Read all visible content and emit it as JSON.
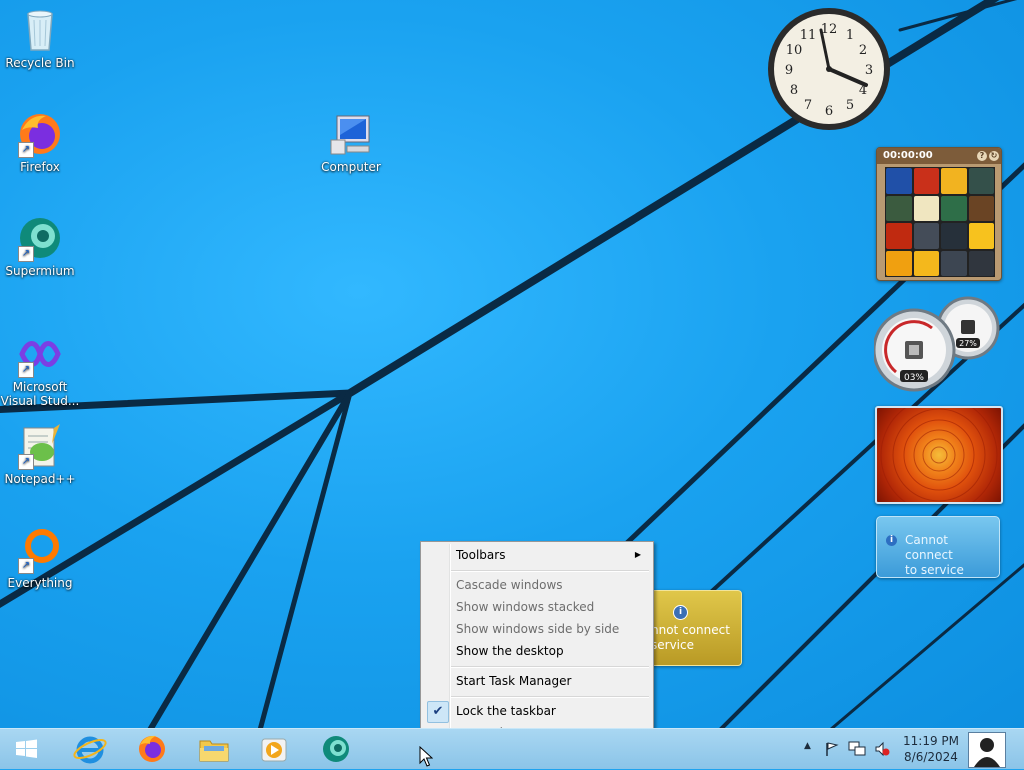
{
  "desktop": {
    "icons": [
      {
        "label": "Recycle Bin",
        "icon": "recycle-bin-icon"
      },
      {
        "label": "Firefox",
        "icon": "firefox-icon"
      },
      {
        "label": "Supermium",
        "icon": "supermium-icon"
      },
      {
        "label": "Microsoft Visual Stud...",
        "icon": "visual-studio-icon"
      },
      {
        "label": "Notepad++",
        "icon": "notepadpp-icon"
      },
      {
        "label": "Everything",
        "icon": "everything-icon"
      },
      {
        "label": "Computer",
        "icon": "computer-icon"
      }
    ]
  },
  "gadgets": {
    "clock": {
      "numerals": [
        "12",
        "1",
        "2",
        "3",
        "4",
        "5",
        "6",
        "7",
        "8",
        "9",
        "10",
        "11"
      ]
    },
    "puzzle": {
      "timer": "00:00:00",
      "help_button": "?",
      "restart_button": "↻"
    },
    "meter": {
      "cpu_percent": "03%",
      "memory_percent": "27%"
    },
    "weather": {
      "info_glyph": "i",
      "line1": "Cannot connect",
      "line2": "to service"
    },
    "feed": {
      "info_glyph": "i",
      "line1": "nnot connect",
      "line2": "service"
    }
  },
  "context_menu": {
    "items": [
      {
        "label": "Toolbars",
        "submenu_arrow": "▶"
      },
      {
        "label": "Cascade windows"
      },
      {
        "label": "Show windows stacked"
      },
      {
        "label": "Show windows side by side"
      },
      {
        "label": "Show the desktop"
      },
      {
        "label": "Start Task Manager"
      },
      {
        "label": "Lock the taskbar",
        "check": "✔"
      },
      {
        "label": "Properties"
      }
    ]
  },
  "taskbar": {
    "pinned": [
      "start-button",
      "internet-explorer",
      "firefox",
      "file-explorer",
      "media-player",
      "supermium"
    ],
    "tray": {
      "show_hidden": "▲",
      "time": "11:19 PM",
      "date": "8/6/2024"
    }
  },
  "colors": {
    "desktop_bg": "#1aa2f0",
    "taskbar_bg": "#9bcdee",
    "menu_bg": "#f0f0f0"
  }
}
